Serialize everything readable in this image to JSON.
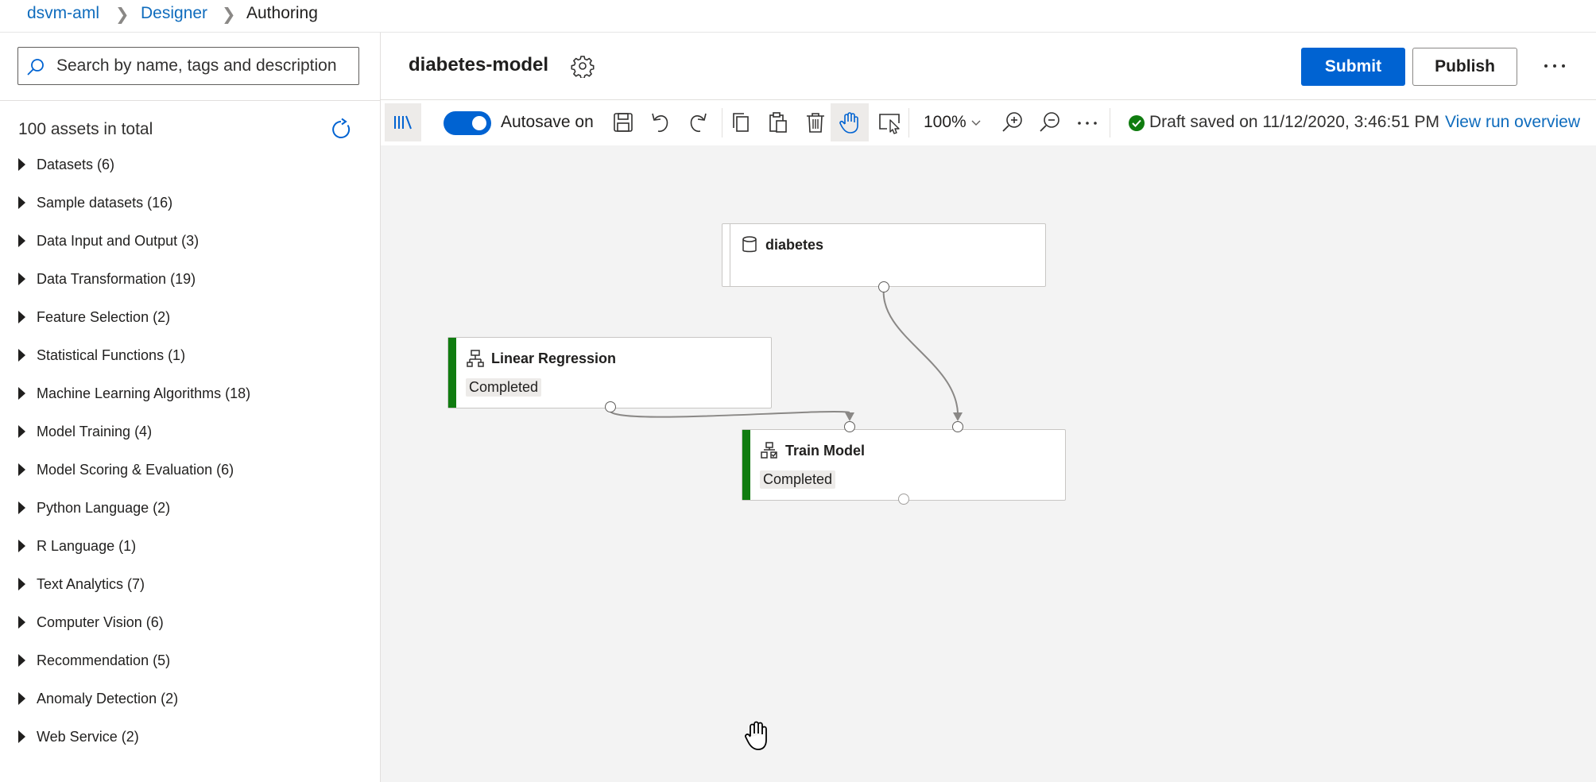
{
  "breadcrumb": {
    "workspace": "dsvm-aml",
    "section": "Designer",
    "current": "Authoring"
  },
  "search": {
    "placeholder": "Search by name, tags and description",
    "value": ""
  },
  "assets": {
    "total_label": "100 assets in total",
    "categories": [
      "Datasets (6)",
      "Sample datasets (16)",
      "Data Input and Output (3)",
      "Data Transformation (19)",
      "Feature Selection (2)",
      "Statistical Functions (1)",
      "Machine Learning Algorithms (18)",
      "Model Training (4)",
      "Model Scoring & Evaluation (6)",
      "Python Language (2)",
      "R Language (1)",
      "Text Analytics (7)",
      "Computer Vision (6)",
      "Recommendation (5)",
      "Anomaly Detection (2)",
      "Web Service (2)"
    ]
  },
  "header": {
    "pipeline_name": "diabetes-model",
    "submit_label": "Submit",
    "publish_label": "Publish"
  },
  "toolbar": {
    "autosave_label": "Autosave on",
    "autosave_enabled": true,
    "zoom": "100%",
    "draft_status": "Draft saved on 11/12/2020, 3:46:51 PM",
    "view_run_label": "View run overview"
  },
  "nodes": {
    "dataset": {
      "title": "diabetes",
      "icon": "database-icon"
    },
    "linear_regression": {
      "title": "Linear Regression",
      "status": "Completed",
      "icon": "hierarchy-icon"
    },
    "train_model": {
      "title": "Train Model",
      "status": "Completed",
      "icon": "train-model-icon"
    }
  },
  "colors": {
    "accent": "#0063d2",
    "link": "#0f6cbd",
    "success": "#107c10",
    "canvas": "#f3f3f3"
  }
}
